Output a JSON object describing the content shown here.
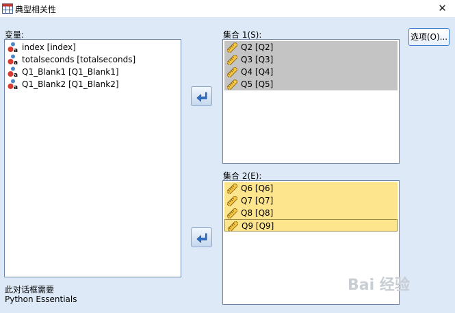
{
  "window": {
    "title": "典型相关性",
    "close_glyph": "✕"
  },
  "variables": {
    "label": "变量:",
    "items": [
      "index [index]",
      "totalseconds [totalseconds]",
      "Q1_Blank1 [Q1_Blank1]",
      "Q1_Blank2 [Q1_Blank2]"
    ]
  },
  "set1": {
    "label": "集合 1(S):",
    "items": [
      "Q2 [Q2]",
      "Q3 [Q3]",
      "Q4 [Q4]",
      "Q5 [Q5]"
    ]
  },
  "set2": {
    "label": "集合 2(E):",
    "items": [
      "Q6 [Q6]",
      "Q7 [Q7]",
      "Q8 [Q8]",
      "Q9 [Q9]"
    ]
  },
  "options_button": "选项(O)...",
  "footer": {
    "line1": "此对话框需要",
    "line2": "Python Essentials"
  },
  "watermark": "Bai 经验",
  "colors": {
    "selection_gray": "#c4c4c4",
    "selection_yellow": "#fde58e",
    "dialog_bg": "#dde9f7",
    "arrow_blue": "#2f6fc6"
  },
  "icons": {
    "nominal": "nominal-variable-icon",
    "scale": "scale-ruler-icon",
    "move": "move-arrow-icon"
  }
}
